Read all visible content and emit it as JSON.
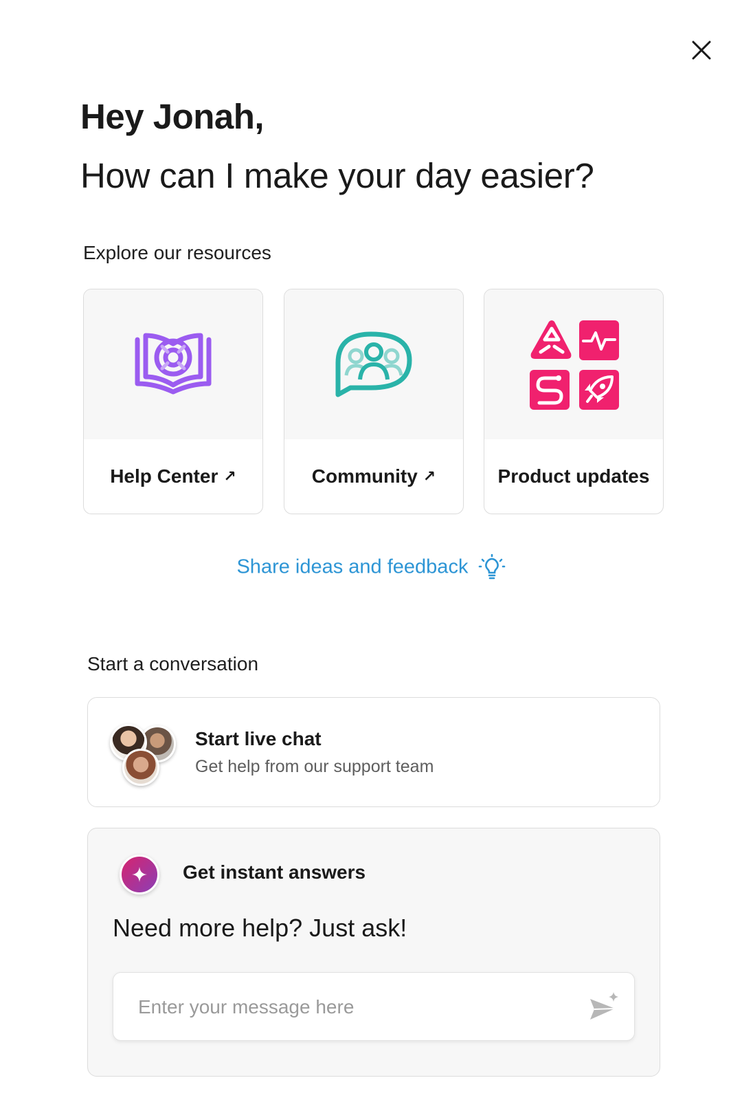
{
  "header": {
    "greeting": "Hey Jonah,",
    "question": "How can I make your day easier?"
  },
  "resources": {
    "title": "Explore our resources",
    "cards": [
      {
        "label": "Help Center",
        "arrow": "↗",
        "icon": "book-icon"
      },
      {
        "label": "Community",
        "arrow": "↗",
        "icon": "speech-bubble-people-icon"
      },
      {
        "label": "Product updates",
        "arrow": "",
        "icon": "product-updates-icon"
      }
    ]
  },
  "feedback": {
    "label": "Share ideas and feedback",
    "icon": "lightbulb-icon"
  },
  "conversation": {
    "title": "Start a conversation",
    "live_chat": {
      "title": "Start live chat",
      "subtitle": "Get help from our support team"
    },
    "instant_answers": {
      "title": "Get instant answers",
      "prompt": "Need more help? Just ask!",
      "input_placeholder": "Enter your message here",
      "input_value": ""
    }
  },
  "colors": {
    "help_center": "#9b5cf0",
    "community": "#2ab3a9",
    "product_updates": "#f0216e",
    "link": "#2d95d5",
    "ai_gradient_start": "#d6246e",
    "ai_gradient_end": "#8b3fb6"
  }
}
